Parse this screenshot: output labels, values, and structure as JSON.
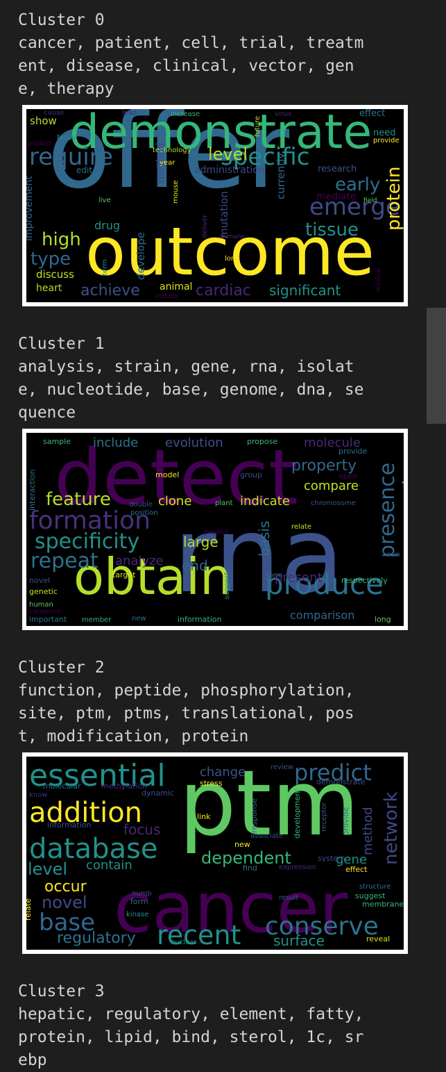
{
  "clusters": [
    {
      "heading": "Cluster 0",
      "lines": [
        "cancer, patient, cell, trial, treatm",
        "ent, disease, clinical, vector, gen",
        "e, therapy"
      ],
      "words": [
        {
          "t": "offer",
          "c": "#31688e",
          "s": 150
        },
        {
          "t": "outcome",
          "c": "#fde725",
          "s": 95
        },
        {
          "t": "demonstrate",
          "c": "#35b779",
          "s": 68
        },
        {
          "t": "require",
          "c": "#31688e",
          "s": 34
        },
        {
          "t": "specific",
          "c": "#21918c",
          "s": 34
        },
        {
          "t": "level",
          "c": "#b5de2b",
          "s": 24
        },
        {
          "t": "emerge",
          "c": "#3e4a89",
          "s": 34
        },
        {
          "t": "early",
          "c": "#2c728e",
          "s": 26
        },
        {
          "t": "tissue",
          "c": "#21918c",
          "s": 26
        },
        {
          "t": "high",
          "c": "#b5de2b",
          "s": 26
        },
        {
          "t": "type",
          "c": "#31688e",
          "s": 26
        },
        {
          "t": "protein",
          "c": "#fde725",
          "s": 26
        },
        {
          "t": "significant",
          "c": "#21918c",
          "s": 20
        },
        {
          "t": "cardiac",
          "c": "#482878",
          "s": 22
        },
        {
          "t": "achieve",
          "c": "#3b528b",
          "s": 22
        },
        {
          "t": "drug",
          "c": "#21918c",
          "s": 16
        },
        {
          "t": "show",
          "c": "#b5de2b",
          "s": 15
        },
        {
          "t": "discuss",
          "c": "#c8e020",
          "s": 15
        },
        {
          "t": "heart",
          "c": "#b5de2b",
          "s": 14
        },
        {
          "t": "animal",
          "c": "#dde318",
          "s": 14
        },
        {
          "t": "administration",
          "c": "#3e4a89",
          "s": 14
        },
        {
          "t": "research",
          "c": "#3b528b",
          "s": 13
        },
        {
          "t": "need",
          "c": "#21918c",
          "s": 13
        },
        {
          "t": "effect",
          "c": "#2c728e",
          "s": 13
        },
        {
          "t": "edit",
          "c": "#2c728e",
          "s": 12
        },
        {
          "t": "live",
          "c": "#5ec962",
          "s": 10
        },
        {
          "t": "long",
          "c": "#fde725",
          "s": 10
        },
        {
          "t": "technology",
          "c": "#b5de2b",
          "s": 10
        },
        {
          "t": "year",
          "c": "#fde725",
          "s": 10
        },
        {
          "t": "focus",
          "c": "#21918c",
          "s": 10
        },
        {
          "t": "increase",
          "c": "#35b779",
          "s": 10
        },
        {
          "t": "virus",
          "c": "#482878",
          "s": 10
        },
        {
          "t": "cause",
          "c": "#46327e",
          "s": 10
        },
        {
          "t": "lead",
          "c": "#46327e",
          "s": 10
        },
        {
          "t": "provide",
          "c": "#fde725",
          "s": 10
        },
        {
          "t": "field",
          "c": "#5ec962",
          "s": 9
        },
        {
          "t": "include",
          "c": "#440154",
          "s": 9
        },
        {
          "t": "immune",
          "c": "#482878",
          "s": 9
        },
        {
          "t": "product",
          "c": "#440154",
          "s": 9
        },
        {
          "t": "mediate",
          "c": "#440154",
          "s": 14
        },
        {
          "t": "improvement",
          "c": "#31688e",
          "s": 14
        },
        {
          "t": "method",
          "c": "#3e4a89",
          "s": 15
        },
        {
          "t": "develope",
          "c": "#31688e",
          "s": 15
        },
        {
          "t": "mouse",
          "c": "#dde318",
          "s": 10
        },
        {
          "t": "deliver",
          "c": "#482878",
          "s": 10
        },
        {
          "t": "mutation",
          "c": "#3e4a89",
          "s": 15
        },
        {
          "t": "currently",
          "c": "#31688e",
          "s": 15
        },
        {
          "t": "future",
          "c": "#b5de2b",
          "s": 10
        },
        {
          "t": "term",
          "c": "#21918c",
          "s": 10
        },
        {
          "t": "residual",
          "c": "#440154",
          "s": 9
        }
      ]
    },
    {
      "heading": "Cluster 1",
      "lines": [
        "analysis, strain, gene, rna, isolat",
        "e, nucleotide, base, genome, dna, se",
        "quence"
      ],
      "words": [
        {
          "t": "detect",
          "c": "#440154",
          "s": 110
        },
        {
          "t": "rna",
          "c": "#3b528b",
          "s": 150
        },
        {
          "t": "obtain",
          "c": "#b5de2b",
          "s": 72
        },
        {
          "t": "produce",
          "c": "#2c728e",
          "s": 42
        },
        {
          "t": "formation",
          "c": "#46327e",
          "s": 36
        },
        {
          "t": "specificity",
          "c": "#21918c",
          "s": 30
        },
        {
          "t": "repeat",
          "c": "#2c728e",
          "s": 30
        },
        {
          "t": "feature",
          "c": "#b5de2b",
          "s": 26
        },
        {
          "t": "presence",
          "c": "#31688e",
          "s": 30
        },
        {
          "t": "genotype",
          "c": "#35b779",
          "s": 26
        },
        {
          "t": "property",
          "c": "#31688e",
          "s": 22
        },
        {
          "t": "compare",
          "c": "#c8e020",
          "s": 18
        },
        {
          "t": "include",
          "c": "#2c728e",
          "s": 18
        },
        {
          "t": "evolution",
          "c": "#3b528b",
          "s": 18
        },
        {
          "t": "molecule",
          "c": "#482878",
          "s": 18
        },
        {
          "t": "large",
          "c": "#b5de2b",
          "s": 20
        },
        {
          "t": "analyze",
          "c": "#482878",
          "s": 18
        },
        {
          "t": "end",
          "c": "#31688e",
          "s": 20
        },
        {
          "t": "clone",
          "c": "#dde318",
          "s": 18
        },
        {
          "t": "indicate",
          "c": "#c8e020",
          "s": 18
        },
        {
          "t": "present",
          "c": "#482878",
          "s": 18
        },
        {
          "t": "basis",
          "c": "#2c728e",
          "s": 20
        },
        {
          "t": "comparison",
          "c": "#31688e",
          "s": 16
        },
        {
          "t": "interaction",
          "c": "#2c728e",
          "s": 11
        },
        {
          "t": "sample",
          "c": "#35b779",
          "s": 11
        },
        {
          "t": "propose",
          "c": "#35b779",
          "s": 11
        },
        {
          "t": "provide",
          "c": "#2c728e",
          "s": 11
        },
        {
          "t": "model",
          "c": "#fde725",
          "s": 11
        },
        {
          "t": "group",
          "c": "#3e4a89",
          "s": 11
        },
        {
          "t": "open",
          "c": "#440154",
          "s": 11
        },
        {
          "t": "double",
          "c": "#3b528b",
          "s": 10
        },
        {
          "t": "position",
          "c": "#2c728e",
          "s": 10
        },
        {
          "t": "plant",
          "c": "#5ec962",
          "s": 10
        },
        {
          "t": "chromosome",
          "c": "#3b528b",
          "s": 10
        },
        {
          "t": "predict",
          "c": "#440154",
          "s": 10
        },
        {
          "t": "relate",
          "c": "#c8e020",
          "s": 10
        },
        {
          "t": "target",
          "c": "#dde318",
          "s": 11
        },
        {
          "t": "form",
          "c": "#2c728e",
          "s": 10
        },
        {
          "t": "non",
          "c": "#3b528b",
          "s": 10
        },
        {
          "t": "novel",
          "c": "#3b528b",
          "s": 11
        },
        {
          "t": "genetic",
          "c": "#c8e020",
          "s": 11
        },
        {
          "t": "human",
          "c": "#5ec962",
          "s": 10
        },
        {
          "t": "conserve",
          "c": "#440154",
          "s": 10
        },
        {
          "t": "important",
          "c": "#2c728e",
          "s": 11
        },
        {
          "t": "member",
          "c": "#35b779",
          "s": 10
        },
        {
          "t": "new",
          "c": "#2c728e",
          "s": 10
        },
        {
          "t": "information",
          "c": "#35b779",
          "s": 11
        },
        {
          "t": "suggest",
          "c": "#21918c",
          "s": 10
        },
        {
          "t": "respectively",
          "c": "#35b779",
          "s": 11
        },
        {
          "t": "long",
          "c": "#5ec962",
          "s": 11
        }
      ]
    },
    {
      "heading": "Cluster 2",
      "lines": [
        "function, peptide, phosphorylation,",
        "site, ptm, ptms, translational, pos",
        "t, modification, protein"
      ],
      "words": [
        {
          "t": "ptm",
          "c": "#5ec962",
          "s": 130
        },
        {
          "t": "cancer",
          "c": "#440154",
          "s": 100
        },
        {
          "t": "essential",
          "c": "#21918c",
          "s": 44
        },
        {
          "t": "addition",
          "c": "#fde725",
          "s": 40
        },
        {
          "t": "database",
          "c": "#21918c",
          "s": 40
        },
        {
          "t": "recent",
          "c": "#21918c",
          "s": 38
        },
        {
          "t": "conserve",
          "c": "#2c728e",
          "s": 36
        },
        {
          "t": "predict",
          "c": "#31688e",
          "s": 32
        },
        {
          "t": "dependent",
          "c": "#35b779",
          "s": 24
        },
        {
          "t": "base",
          "c": "#31688e",
          "s": 34
        },
        {
          "t": "network",
          "c": "#3e4a89",
          "s": 26
        },
        {
          "t": "level",
          "c": "#21918c",
          "s": 24
        },
        {
          "t": "novel",
          "c": "#3e4a89",
          "s": 24
        },
        {
          "t": "occur",
          "c": "#fde725",
          "s": 22
        },
        {
          "t": "regulatory",
          "c": "#2c728e",
          "s": 22
        },
        {
          "t": "contain",
          "c": "#21918c",
          "s": 18
        },
        {
          "t": "surface",
          "c": "#21918c",
          "s": 20
        },
        {
          "t": "change",
          "c": "#3b528b",
          "s": 18
        },
        {
          "t": "focus",
          "c": "#482878",
          "s": 20
        },
        {
          "t": "gene",
          "c": "#21918c",
          "s": 18
        },
        {
          "t": "method",
          "c": "#3e4a89",
          "s": 18
        },
        {
          "t": "stress",
          "c": "#fde725",
          "s": 11
        },
        {
          "t": "dynamic",
          "c": "#3b528b",
          "s": 11
        },
        {
          "t": "molecular",
          "c": "#2c728e",
          "s": 11
        },
        {
          "t": "methylation",
          "c": "#46327e",
          "s": 11
        },
        {
          "t": "know",
          "c": "#46327e",
          "s": 10
        },
        {
          "t": "information",
          "c": "#3b528b",
          "s": 11
        },
        {
          "t": "link",
          "c": "#fde725",
          "s": 11
        },
        {
          "t": "new",
          "c": "#fde725",
          "s": 11
        },
        {
          "t": "response",
          "c": "#31688e",
          "s": 11
        },
        {
          "t": "development",
          "c": "#35b779",
          "s": 11
        },
        {
          "t": "receptor",
          "c": "#3b528b",
          "s": 10
        },
        {
          "t": "provide",
          "c": "#31688e",
          "s": 11
        },
        {
          "t": "find",
          "c": "#2c728e",
          "s": 11
        },
        {
          "t": "expression",
          "c": "#482878",
          "s": 10
        },
        {
          "t": "system",
          "c": "#3e4a89",
          "s": 11
        },
        {
          "t": "effect",
          "c": "#fde725",
          "s": 11
        },
        {
          "t": "demonstrate",
          "c": "#3b528b",
          "s": 11
        },
        {
          "t": "review",
          "c": "#3b528b",
          "s": 10
        },
        {
          "t": "numb",
          "c": "#3e4a89",
          "s": 10
        },
        {
          "t": "form",
          "c": "#31688e",
          "s": 11
        },
        {
          "t": "result",
          "c": "#3b528b",
          "s": 10
        },
        {
          "t": "kinase",
          "c": "#21918c",
          "s": 10
        },
        {
          "t": "nuclear",
          "c": "#21918c",
          "s": 10
        },
        {
          "t": "structure",
          "c": "#2c728e",
          "s": 10
        },
        {
          "t": "suggest",
          "c": "#35b779",
          "s": 11
        },
        {
          "t": "membrane",
          "c": "#35b779",
          "s": 11
        },
        {
          "t": "reveal",
          "c": "#dde318",
          "s": 11
        },
        {
          "t": "relate",
          "c": "#fde725",
          "s": 11
        },
        {
          "t": "associate",
          "c": "#3b528b",
          "s": 10
        }
      ]
    },
    {
      "heading": "Cluster 3",
      "lines": [
        "hepatic, regulatory, element, fatty,",
        "protein, lipid, bind, sterol, 1c, sr",
        "ebp"
      ],
      "words": []
    }
  ]
}
